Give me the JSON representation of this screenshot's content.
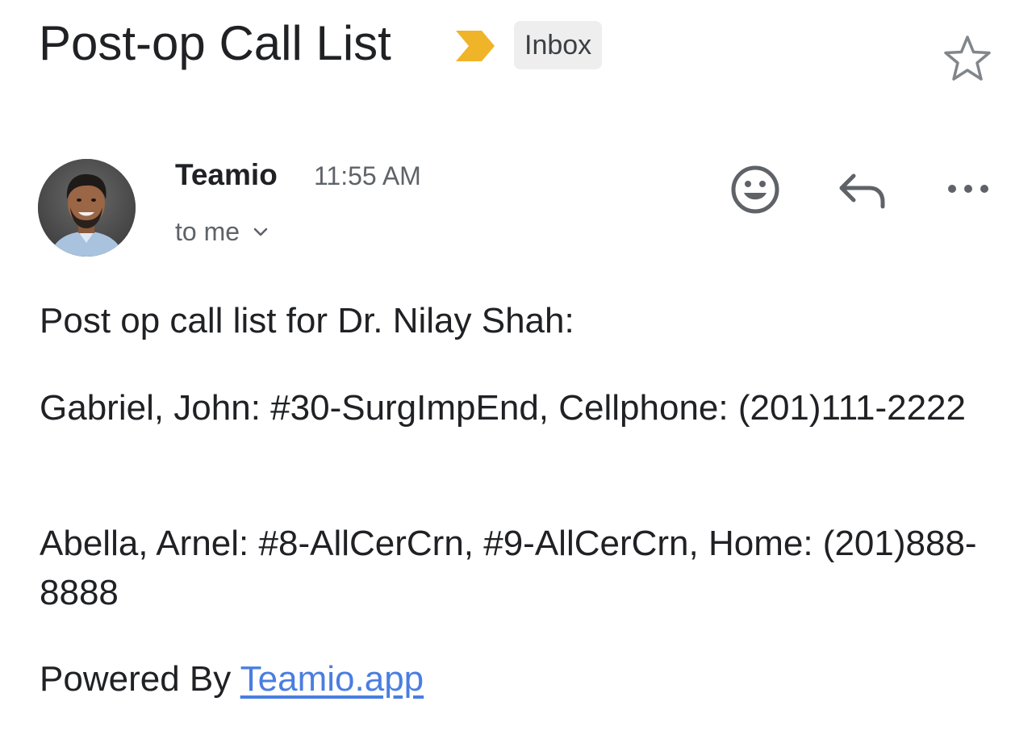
{
  "email": {
    "subject": "Post-op Call List",
    "label": "Inbox",
    "sender": {
      "name": "Teamio",
      "time": "11:55 AM",
      "recipients": "to me"
    },
    "body": {
      "intro": "Post op call list for Dr. Nilay Shah:",
      "entries": [
        "Gabriel, John: #30-SurgImpEnd, Cellphone: (201)111-2222",
        "Abella, Arnel: #8-AllCerCrn, #9-AllCerCrn, Home: (201)888-8888"
      ],
      "footer_prefix": "Powered By ",
      "footer_link": "Teamio.app"
    }
  },
  "icons": {
    "importance": "importance-marker-icon",
    "star": "star-outline-icon",
    "emoji": "add-reaction-icon",
    "reply": "reply-icon",
    "more": "more-horizontal-icon",
    "chevron": "chevron-down-icon"
  },
  "colors": {
    "importance": "#f0b429",
    "link": "#4a7ee0",
    "label_bg": "#eeeeee",
    "secondary_text": "#5f6368"
  }
}
